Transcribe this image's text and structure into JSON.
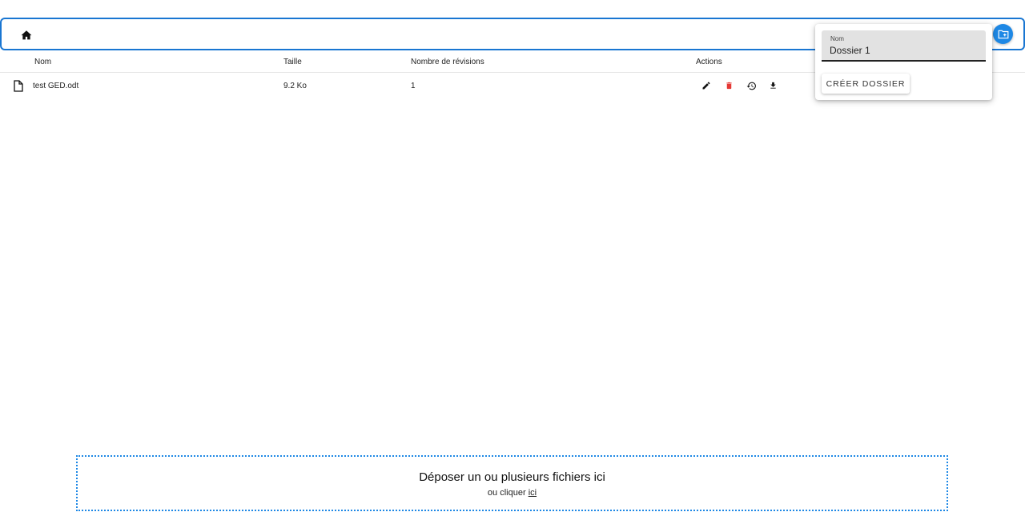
{
  "table": {
    "headers": {
      "name": "Nom",
      "size": "Taille",
      "revisions": "Nombre de révisions",
      "actions": "Actions"
    },
    "rows": [
      {
        "name": "test GED.odt",
        "size": "9.2 Ko",
        "revisions": "1",
        "icons": [
          "file-icon",
          "edit-icon",
          "delete-icon",
          "history-icon",
          "download-icon"
        ]
      }
    ]
  },
  "popover": {
    "field_label": "Nom",
    "field_value": "Dossier 1",
    "create_label": "CRÉER DOSSIER"
  },
  "dropzone": {
    "title": "Déposer un ou plusieurs fichiers ici",
    "subtitle": "ou cliquer",
    "link": "ici"
  },
  "colors": {
    "accent": "#1e88e5",
    "border": "#1976d2",
    "delete": "#e53935"
  }
}
